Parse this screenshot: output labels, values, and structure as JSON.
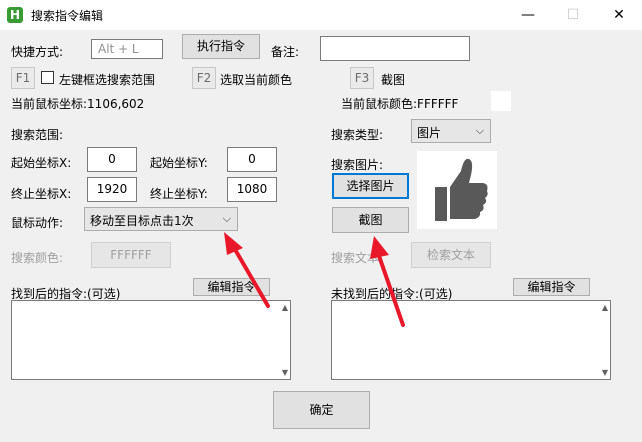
{
  "window": {
    "app_icon_letter": "H",
    "title": "搜索指令编辑",
    "controls": {
      "minimize": "—",
      "maximize": "☐",
      "close": "✕"
    }
  },
  "hotkey": {
    "label": "快捷方式:",
    "value": "Alt + L",
    "exec_button": "执行指令",
    "note_label": "备注:",
    "note_value": ""
  },
  "fkeys": {
    "f1": "F1",
    "f1_checkbox_label": "左键框选搜索范围",
    "f1_checked": false,
    "f2": "F2",
    "f2_label": "选取当前颜色",
    "f3": "F3",
    "f3_label": "截图"
  },
  "mouse": {
    "coord_label": "当前鼠标坐标:1106,602",
    "color_label": "当前鼠标颜色:FFFFFF",
    "color_value": "#FFFFFF"
  },
  "range": {
    "title": "搜索范围:",
    "start_x_label": "起始坐标X:",
    "start_x": "0",
    "start_y_label": "起始坐标Y:",
    "start_y": "0",
    "end_x_label": "终止坐标X:",
    "end_x": "1920",
    "end_y_label": "终止坐标Y:",
    "end_y": "1080"
  },
  "action": {
    "label": "鼠标动作:",
    "selected": "移动至目标点击1次"
  },
  "search_color": {
    "label": "搜索颜色:",
    "value": "FFFFFF"
  },
  "search_type": {
    "label": "搜索类型:",
    "selected": "图片",
    "image_label": "搜索图片:",
    "select_image_button": "选择图片",
    "screenshot_button": "截图",
    "text_label": "搜索文本",
    "search_text_button": "检索文本"
  },
  "found": {
    "label": "找到后的指令:(可选)",
    "edit_button": "编辑指令",
    "value": ""
  },
  "not_found": {
    "label": "未找到后的指令:(可选)",
    "edit_button": "编辑指令",
    "value": ""
  },
  "confirm_button": "确定",
  "colors": {
    "accent": "#0078d7",
    "arrow": "#e8182a",
    "app_icon": "#3a9b35",
    "thumb_icon": "#595959"
  },
  "icons": {
    "thumbnail": "thumbs-up-icon"
  }
}
